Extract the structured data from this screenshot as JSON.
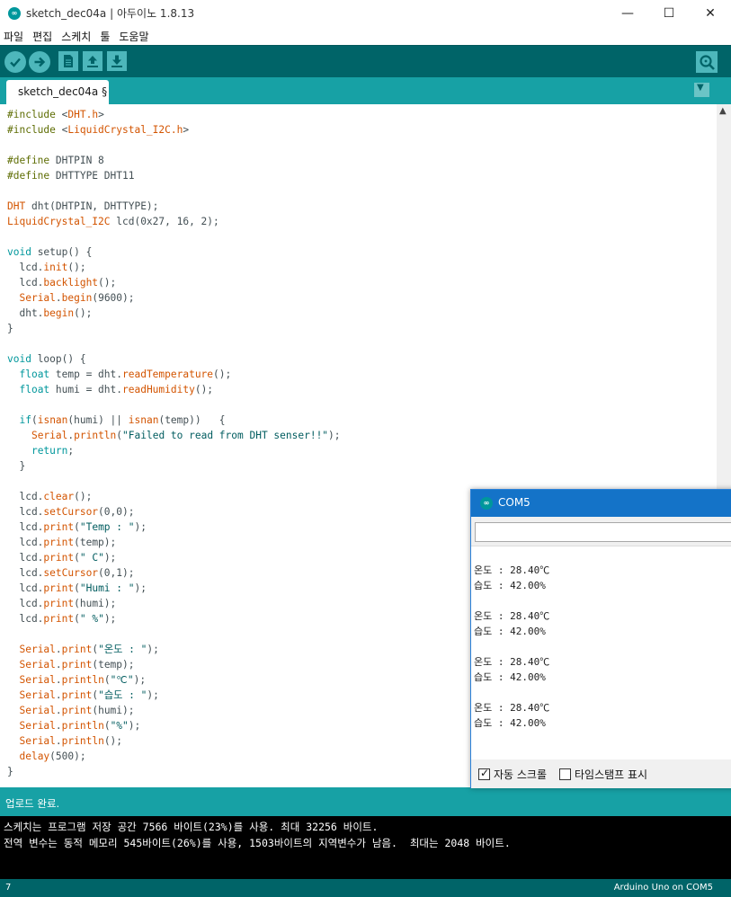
{
  "window": {
    "logo": "∞",
    "title": "sketch_dec04a | 아두이노 1.8.13",
    "minimize": "—",
    "maximize": "☐",
    "close": "✕"
  },
  "menu": [
    "파일",
    "편집",
    "스케치",
    "툴",
    "도움말"
  ],
  "toolbar": {
    "icons": [
      "verify-icon",
      "upload-icon",
      "new-icon",
      "open-icon",
      "save-icon",
      "serial-monitor-icon"
    ],
    "accent": "#006468"
  },
  "tab": {
    "label": "sketch_dec04a §",
    "menu_icon": "▼"
  },
  "code": [
    "#include <DHT.h>",
    "#include <LiquidCrystal_I2C.h>",
    "",
    "#define DHTPIN 8",
    "#define DHTTYPE DHT11",
    "",
    "DHT dht(DHTPIN, DHTTYPE);",
    "LiquidCrystal_I2C lcd(0x27, 16, 2);",
    "",
    "void setup() {",
    "  lcd.init();",
    "  lcd.backlight();",
    "  Serial.begin(9600);",
    "  dht.begin();",
    "}",
    "",
    "void loop() {",
    "  float temp = dht.readTemperature();",
    "  float humi = dht.readHumidity();",
    "",
    "  if(isnan(humi) || isnan(temp))   {",
    "    Serial.println(\"Failed to read from DHT senser!!\");",
    "    return;",
    "  }",
    "",
    "  lcd.clear();",
    "  lcd.setCursor(0,0);",
    "  lcd.print(\"Temp : \");",
    "  lcd.print(temp);",
    "  lcd.print(\" C\");",
    "  lcd.setCursor(0,1);",
    "  lcd.print(\"Humi : \");",
    "  lcd.print(humi);",
    "  lcd.print(\" %\");",
    "",
    "  Serial.print(\"온도 : \");",
    "  Serial.print(temp);",
    "  Serial.println(\"℃\");",
    "  Serial.print(\"습도 : \");",
    "  Serial.print(humi);",
    "  Serial.println(\"%\");",
    "  Serial.println();",
    "  delay(500);",
    "}"
  ],
  "status": "업로드 완료.",
  "console": [
    "스케치는 프로그램 저장 공간 7566 바이트(23%)를 사용. 최대 32256 바이트.",
    "전역 변수는 동적 메모리 545바이트(26%)를 사용, 1503바이트의 지역변수가 남음.  최대는 2048 바이트."
  ],
  "bottom": {
    "line_number": "7",
    "board": "Arduino Uno on COM5"
  },
  "serial_monitor": {
    "logo": "∞",
    "title": "COM5",
    "input_value": "",
    "output": [
      "온도 : 28.40℃",
      "습도 : 42.00%",
      "",
      "온도 : 28.40℃",
      "습도 : 42.00%",
      "",
      "온도 : 28.40℃",
      "습도 : 42.00%",
      "",
      "온도 : 28.40℃",
      "습도 : 42.00%"
    ],
    "autoscroll_label": "자동 스크롤",
    "autoscroll_checked": true,
    "timestamp_label": "타임스탬프 표시",
    "timestamp_checked": false,
    "checkmark": "✓"
  }
}
